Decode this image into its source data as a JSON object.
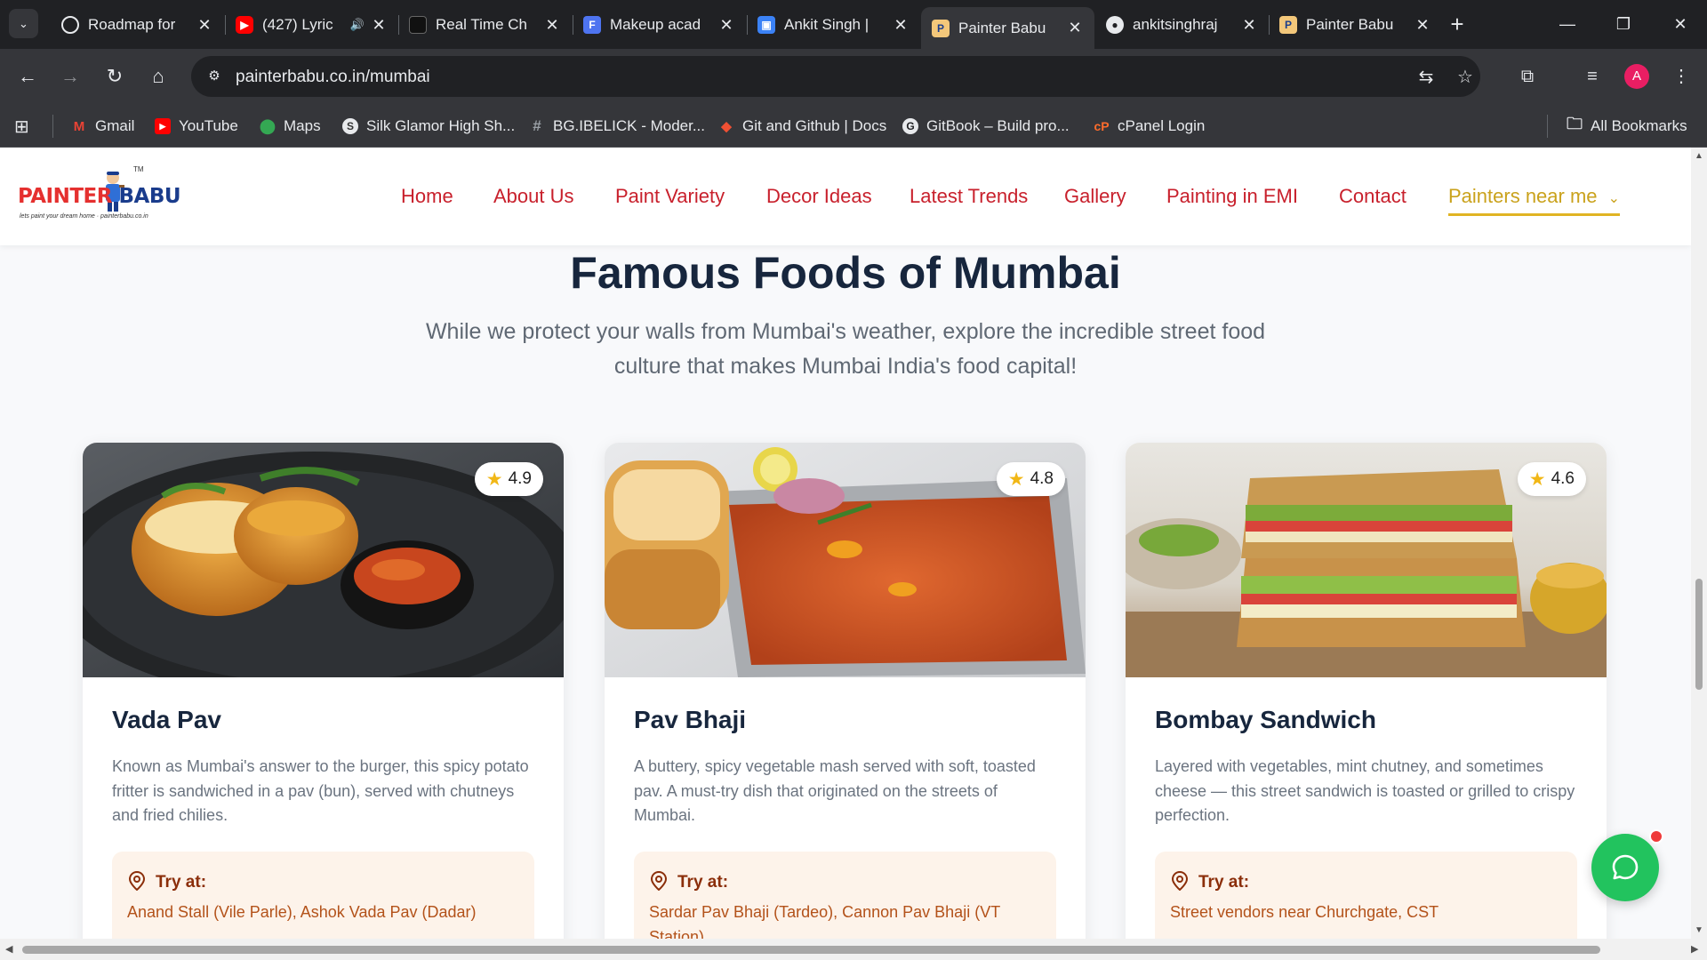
{
  "browser": {
    "tabs": [
      {
        "title": "Roadmap for",
        "icon": "chatgpt-icon",
        "color": "#ffffff"
      },
      {
        "title": "(427) Lyric",
        "icon": "youtube-icon",
        "color": "#ff0000"
      },
      {
        "title": "Real Time Ch",
        "icon": "app-icon",
        "color": "#222222"
      },
      {
        "title": "Makeup acad",
        "icon": "forms-icon",
        "color": "#4e74f0"
      },
      {
        "title": "Ankit Singh |",
        "icon": "briefcase-icon",
        "color": "#3b82f6"
      },
      {
        "title": "Painter Babu",
        "icon": "painter-babu-icon",
        "color": "#ffffff",
        "active": true
      },
      {
        "title": "ankitsinghraj",
        "icon": "github-icon",
        "color": "#ffffff"
      },
      {
        "title": "Painter Babu",
        "icon": "painter-babu-icon",
        "color": "#ffffff"
      }
    ],
    "url": "painterbabu.co.in/mumbai",
    "avatar_letter": "A",
    "bookmarks": [
      {
        "label": "Gmail",
        "icon": "gmail-icon"
      },
      {
        "label": "YouTube",
        "icon": "youtube-icon"
      },
      {
        "label": "Maps",
        "icon": "maps-icon"
      },
      {
        "label": "Silk Glamor High Sh...",
        "icon": "silk-icon"
      },
      {
        "label": "BG.IBELICK - Moder...",
        "icon": "hash-icon"
      },
      {
        "label": "Git and Github | Docs",
        "icon": "git-icon"
      },
      {
        "label": "GitBook – Build pro...",
        "icon": "gitbook-icon"
      },
      {
        "label": "cPanel Login",
        "icon": "cpanel-icon"
      }
    ],
    "all_bookmarks": "All Bookmarks"
  },
  "site": {
    "logo": {
      "part1": "PAINTER",
      "part2": "BABU",
      "tm": "TM",
      "tagline": "lets paint your dream home · painterbabu.co.in"
    },
    "nav": [
      "Home",
      "About Us",
      "Paint Variety",
      "Decor Ideas",
      "Latest Trends",
      "Gallery",
      "Painting in EMI",
      "Contact",
      "Painters near me"
    ],
    "nav_active": "Painters near me"
  },
  "section": {
    "title": "Famous Foods of Mumbai",
    "subtitle": "While we protect your walls from Mumbai's weather, explore the incredible street food culture that makes Mumbai India's food capital!"
  },
  "foods": [
    {
      "name": "Vada Pav",
      "rating": "4.9",
      "description": "Known as Mumbai's answer to the burger, this spicy potato fritter is sandwiched in a pav (bun), served with chutneys and fried chilies.",
      "try_label": "Try at:",
      "try_at": "Anand Stall (Vile Parle), Ashok Vada Pav (Dadar)"
    },
    {
      "name": "Pav Bhaji",
      "rating": "4.8",
      "description": "A buttery, spicy vegetable mash served with soft, toasted pav. A must-try dish that originated on the streets of Mumbai.",
      "try_label": "Try at:",
      "try_at": "Sardar Pav Bhaji (Tardeo), Cannon Pav Bhaji (VT Station)"
    },
    {
      "name": "Bombay Sandwich",
      "rating": "4.6",
      "description": "Layered with vegetables, mint chutney, and sometimes cheese — this street sandwich is toasted or grilled to crispy perfection.",
      "try_label": "Try at:",
      "try_at": "Street vendors near Churchgate, CST"
    }
  ],
  "colors": {
    "nav": "#c8202c",
    "nav_active": "#caa21c",
    "heading": "#17263d",
    "try_bg": "#fdf3ea",
    "try_text": "#b3521a",
    "chat": "#22c35e"
  }
}
